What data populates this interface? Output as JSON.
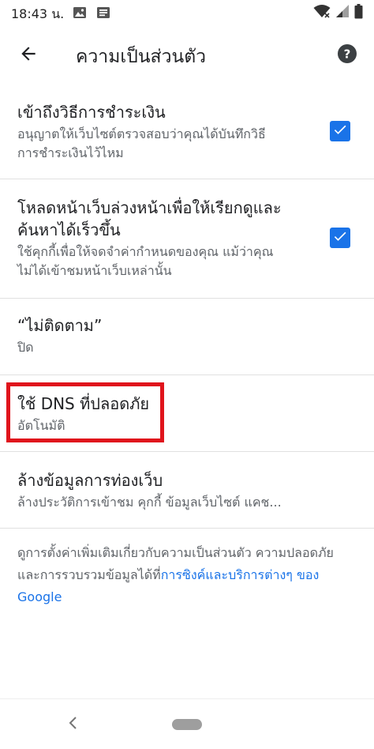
{
  "status_bar": {
    "time": "18:43 น.",
    "icons": [
      "image-icon",
      "message-icon",
      "wifi-icon",
      "signal-icon",
      "battery-icon"
    ]
  },
  "app_bar": {
    "title": "ความเป็นส่วนตัว",
    "back_icon": "arrow-back-icon",
    "help_icon": "help-icon"
  },
  "settings": [
    {
      "title": "เข้าถึงวิธีการชำระเงิน",
      "subtitle_lines": [
        "อนุญาตให้เว็บไซต์ตรวจสอบว่าคุณได้บันทึกวิธี",
        "การชำระเงินไว้ไหม"
      ],
      "checked": true
    },
    {
      "title_lines": [
        "โหลดหน้าเว็บล่วงหน้าเพื่อให้เรียกดูและ",
        "ค้นหาได้เร็วขึ้น"
      ],
      "subtitle_lines": [
        "ใช้คุกกี้เพื่อให้จดจำค่ากำหนดของคุณ แม้ว่าคุณ",
        "ไม่ได้เข้าชมหน้าเว็บเหล่านั้น"
      ],
      "checked": true
    },
    {
      "title": "“ไม่ติดตาม”",
      "subtitle": "ปิด"
    },
    {
      "title": "ใช้ DNS ที่ปลอดภัย",
      "subtitle": "อัตโนมัติ"
    },
    {
      "title": "ล้างข้อมูลการท่องเว็บ",
      "subtitle": "ล้างประวัติการเข้าชม คุกกี้ ข้อมูลเว็บไซต์ แคช..."
    }
  ],
  "footer": {
    "text": "ดูการตั้งค่าเพิ่มเติมเกี่ยวกับความเป็นส่วนตัว ความปลอดภัย และการรวบรวมข้อมูลได้ที่",
    "link": "การซิงค์และบริการต่างๆ ของ Google"
  },
  "colors": {
    "accent": "#1a73e8",
    "highlight": "#e0141c",
    "divider": "#e0e0e0"
  }
}
